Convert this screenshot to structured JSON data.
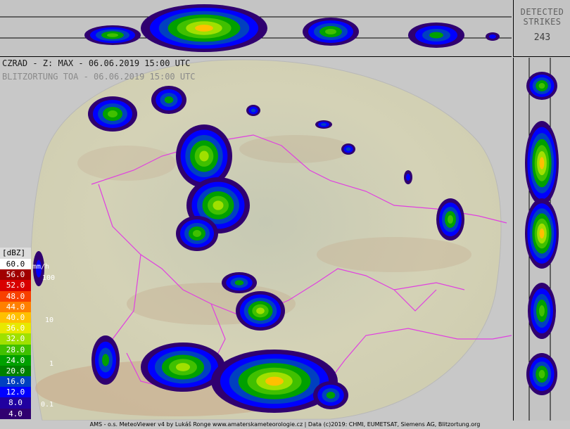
{
  "titles": {
    "radar": "CZRAD - Z: MAX - 06.06.2019 15:00 UTC",
    "lightning": "BLITZORTUNG TOA - 06.06.2019 15:00 UTC"
  },
  "strikes": {
    "label_line1": "DETECTED",
    "label_line2": "STRIKES",
    "count": "243"
  },
  "legend": {
    "unit": "[dBZ]",
    "levels": [
      "60.0",
      "56.0",
      "52.0",
      "48.0",
      "44.0",
      "40.0",
      "36.0",
      "32.0",
      "28.0",
      "24.0",
      "20.0",
      "16.0",
      "12.0",
      "8.0",
      "4.0"
    ],
    "colors": [
      "#ffffff",
      "#a00000",
      "#d80000",
      "#f84000",
      "#ff8000",
      "#ffc000",
      "#e8e800",
      "#a0e000",
      "#40c000",
      "#00a000",
      "#008000",
      "#0040c0",
      "#0000ff",
      "#2000a0",
      "#300070"
    ],
    "rain_unit": "mm/h",
    "rain_marks": [
      "100",
      "10",
      "1",
      "0.1"
    ]
  },
  "footer": "AMS - o.s. MeteoViewer v4 by Lukáš Ronge www.amaterskameteorologie.cz | Data (c)2019: CHMI, EUMETSAT, Siemens AG, Blitzortung.org"
}
